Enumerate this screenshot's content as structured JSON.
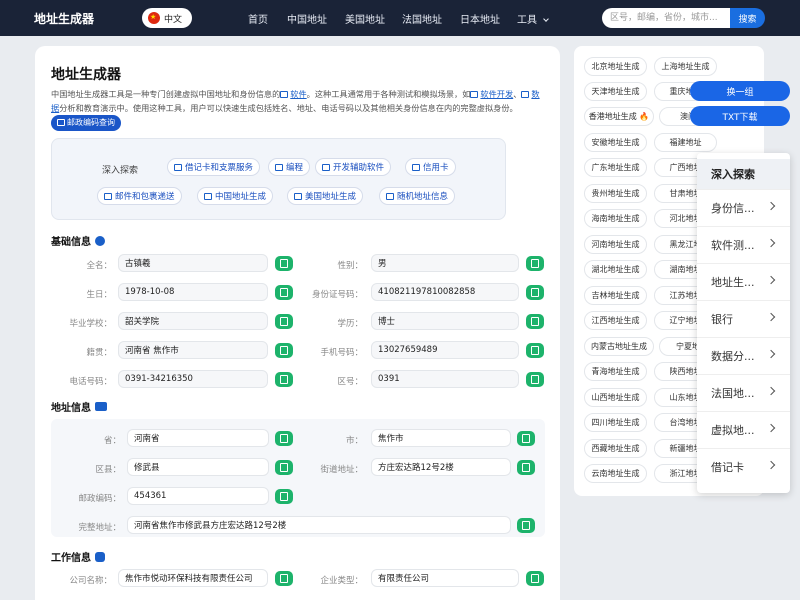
{
  "header": {
    "logo": "地址生成器",
    "lang": "中文",
    "nav": [
      "首页",
      "中国地址",
      "美国地址",
      "法国地址",
      "日本地址",
      "工具"
    ],
    "search_placeholder": "区号，邮编，省份，城市...",
    "search_button": "搜索"
  },
  "main": {
    "title": "地址生成器",
    "intro_1": "中国地址生成器工具是一种专门创建虚拟中国地址和身份信息的",
    "intro_link1": "软件",
    "intro_2": "。这种工具通常用于各种测试和模拟场景，如",
    "intro_link2": "软件开发",
    "intro_3": "、",
    "intro_link3": "数据",
    "intro_4": "分析和教育演示中。使用这种工具，用户可以快速生成包括姓名、地址、电话号码以及其他相关身份信息在内的完整虚拟身份。",
    "postal_pill": "邮政编码查询",
    "explore_label": "深入探索",
    "explore_tags": [
      "借记卡和支票服务",
      "编程",
      "开发辅助软件",
      "信用卡",
      "邮件和包裹递送",
      "中国地址生成",
      "美国地址生成",
      "随机地址信息"
    ]
  },
  "basic": {
    "heading": "基础信息",
    "fields": [
      {
        "label": "全名：",
        "value": "古镇羲"
      },
      {
        "label": "性别：",
        "value": "男"
      },
      {
        "label": "生日：",
        "value": "1978-10-08"
      },
      {
        "label": "身份证号码：",
        "value": "410821197810082858"
      },
      {
        "label": "毕业学校：",
        "value": "韶关学院"
      },
      {
        "label": "学历：",
        "value": "博士"
      },
      {
        "label": "籍贯：",
        "value": "河南省 焦作市"
      },
      {
        "label": "手机号码：",
        "value": "13027659489"
      },
      {
        "label": "电话号码：",
        "value": "0391-34216350"
      },
      {
        "label": "区号：",
        "value": "0391"
      }
    ]
  },
  "address": {
    "heading": "地址信息",
    "fields": [
      {
        "label": "省：",
        "value": "河南省"
      },
      {
        "label": "市：",
        "value": "焦作市"
      },
      {
        "label": "区县：",
        "value": "修武县"
      },
      {
        "label": "街道地址：",
        "value": "方庄宏达路12号2楼"
      },
      {
        "label": "邮政编码：",
        "value": "454361"
      },
      {
        "label": "完整地址：",
        "value": "河南省焦作市修武县方庄宏达路12号2楼"
      }
    ]
  },
  "work": {
    "heading": "工作信息",
    "fields": [
      {
        "label": "公司名称：",
        "value": "焦作市悦动环保科技有限责任公司"
      },
      {
        "label": "企业类型：",
        "value": "有限责任公司"
      }
    ]
  },
  "right": {
    "regions": [
      "北京地址生成",
      "上海地址生成",
      "天津地址生成",
      "重庆地址",
      "香港地址生成 🔥",
      "澳门",
      "安徽地址生成",
      "福建地址",
      "广东地址生成",
      "广西地址",
      "贵州地址生成",
      "甘肃地址",
      "海南地址生成",
      "河北地址",
      "河南地址生成",
      "黑龙江地",
      "湖北地址生成",
      "湖南地址",
      "吉林地址生成",
      "江苏地址",
      "江西地址生成",
      "辽宁地址",
      "内蒙古地址生成",
      "宁夏地",
      "青海地址生成",
      "陕西地址",
      "山西地址生成",
      "山东地址",
      "四川地址生成",
      "台湾地址",
      "西藏地址生成",
      "新疆地址",
      "云南地址生成",
      "浙江地址"
    ],
    "btn_refresh": "换一组",
    "btn_txt": "TXT下载",
    "dropdown_head": "深入探索",
    "dropdown_items": [
      "身份信...",
      "软件测...",
      "地址生...",
      "银行",
      "数据分...",
      "法国地...",
      "虚拟地...",
      "借记卡"
    ]
  }
}
